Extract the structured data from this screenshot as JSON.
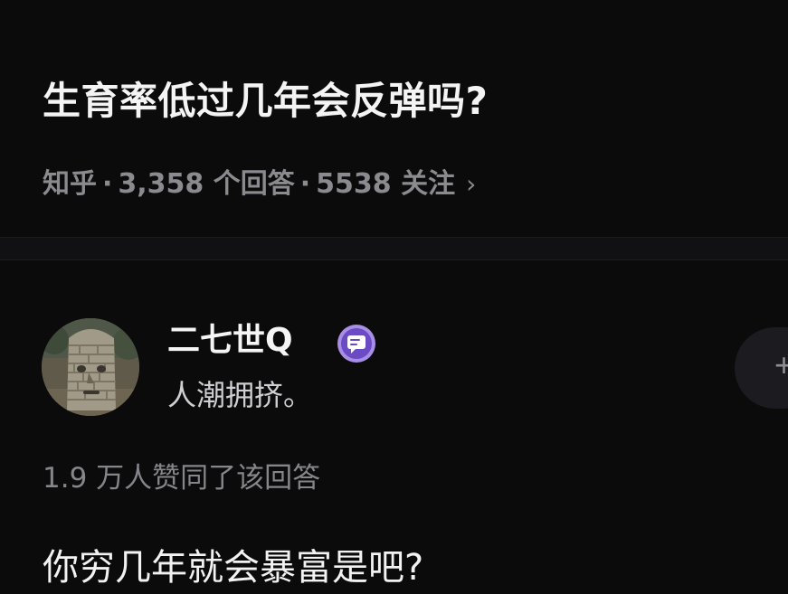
{
  "question": {
    "title": "生育率低过几年会反弹吗?",
    "meta": {
      "source": "知乎",
      "separator": "·",
      "answers": "3,358 个回答",
      "followers": "5538 关注",
      "chevron": "›"
    }
  },
  "answer": {
    "author": {
      "name": "二七世Q",
      "bio": "人潮拥挤。",
      "badge_icon": "chat-bubble-badge-icon",
      "avatar_icon": "stone-statue-avatar"
    },
    "follow_button": {
      "label": "+"
    },
    "votes": "1.9 万人赞同了该回答",
    "text": "你穷几年就会暴富是吧?"
  },
  "colors": {
    "background": "#0b0b0c",
    "divider": "#111113",
    "title": "#f4f4f4",
    "meta": "#8a8a8f",
    "badge": "#7b5ccf"
  }
}
